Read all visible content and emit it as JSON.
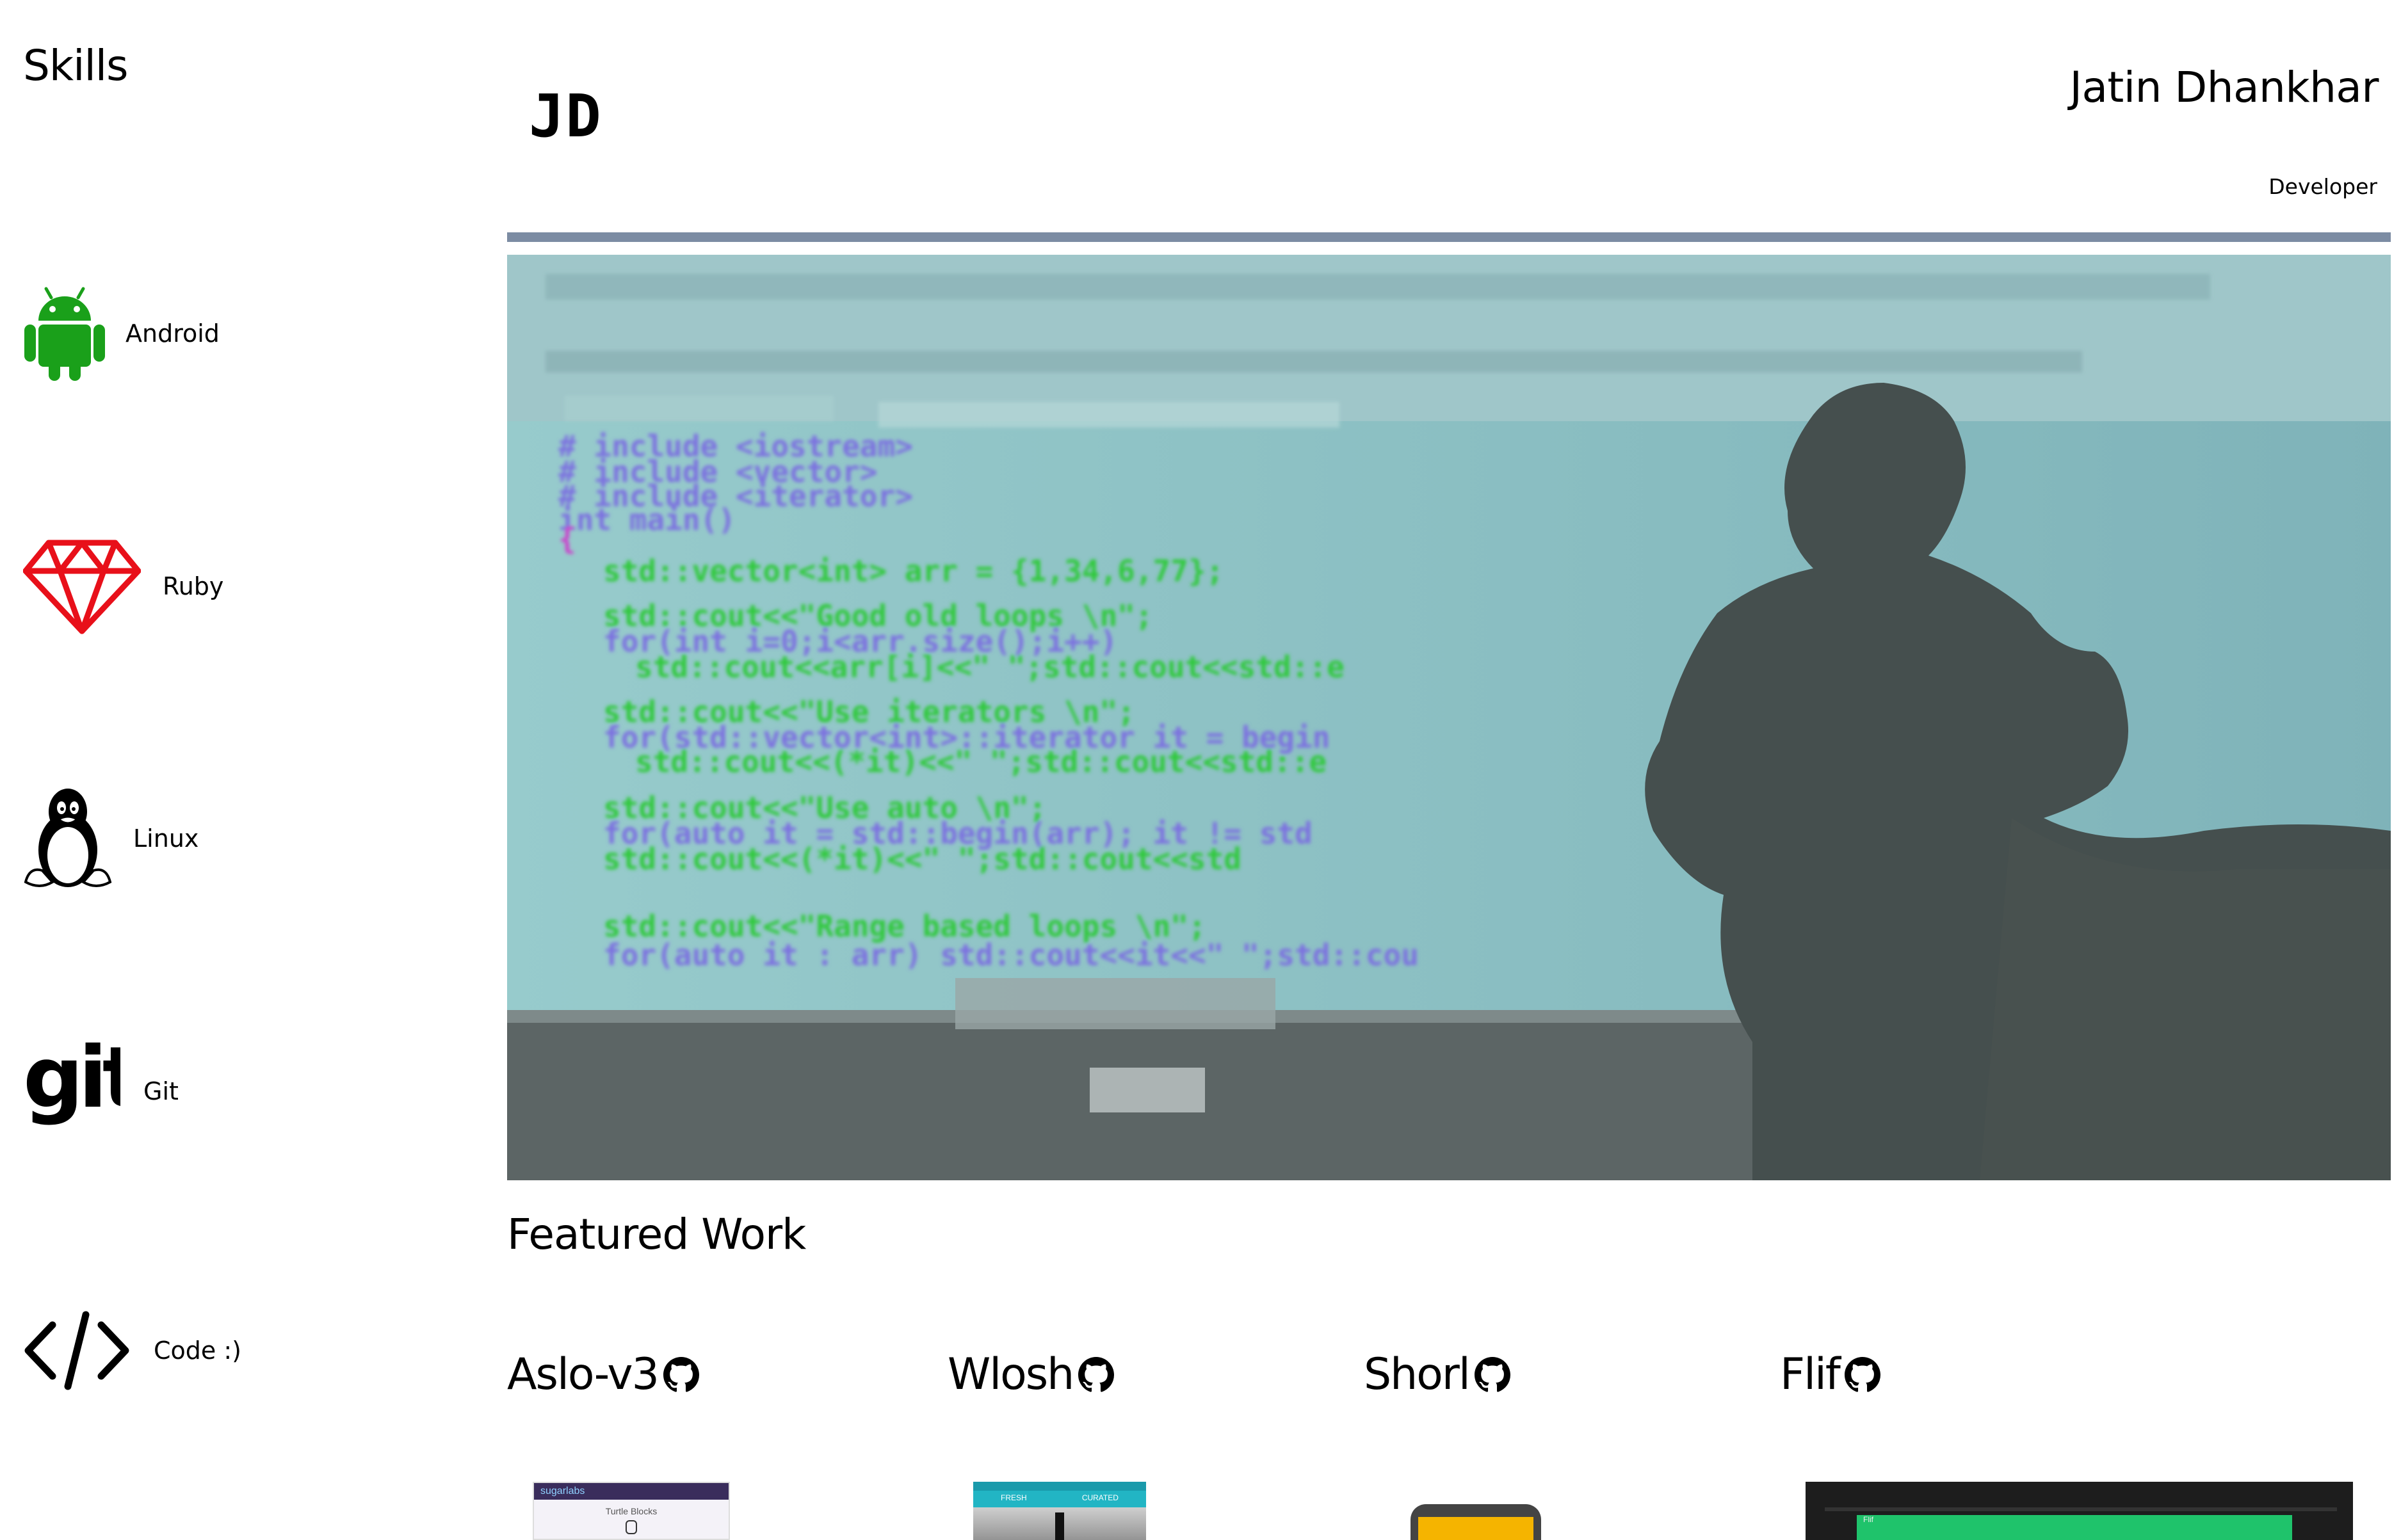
{
  "sidebar": {
    "title": "Skills",
    "items": [
      {
        "label": "Android",
        "icon": "android-icon"
      },
      {
        "label": "Ruby",
        "icon": "ruby-gem-icon"
      },
      {
        "label": "Linux",
        "icon": "linux-tux-icon"
      },
      {
        "label": "Git",
        "icon": "git-logo-icon"
      },
      {
        "label": "Code :)",
        "icon": "code-brackets-icon"
      }
    ]
  },
  "header": {
    "logo": "JD",
    "name": "Jatin Dhankhar",
    "role": "Developer",
    "divider_color": "#7c8ca3"
  },
  "hero": {
    "description_icon": "projector-photo"
  },
  "featured": {
    "title": "Featured Work",
    "projects": [
      {
        "name": "Aslo-v3",
        "icon": "github-icon",
        "thumb_text_1": "sugarlabs",
        "thumb_text_2": "Turtle Blocks"
      },
      {
        "name": "Wlosh",
        "icon": "github-icon",
        "thumb_text_1": "FRESH",
        "thumb_text_2": "CURATED"
      },
      {
        "name": "Shorl",
        "icon": "github-icon"
      },
      {
        "name": "Flif",
        "icon": "github-icon",
        "thumb_text_1": "Flif"
      }
    ]
  },
  "colors": {
    "android_green": "#1aa01a",
    "ruby_red": "#e8101a",
    "code_bg": "#8ec1c3"
  }
}
